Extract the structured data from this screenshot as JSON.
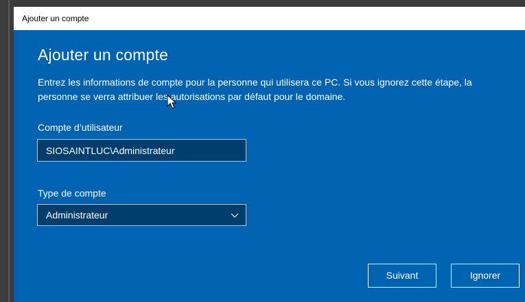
{
  "window": {
    "title": "Ajouter un compte"
  },
  "dialog": {
    "heading": "Ajouter un compte",
    "description": "Entrez les informations de compte pour la personne qui utilisera ce PC. Si vous ignorez cette étape, la personne se verra attribuer les autorisations par défaut pour le domaine."
  },
  "user_account": {
    "label": "Compte d’utilisateur",
    "value": "SIOSAINTLUC\\Administrateur"
  },
  "account_type": {
    "label": "Type de compte",
    "selected": "Administrateur"
  },
  "buttons": {
    "next": "Suivant",
    "ignore": "Ignorer"
  },
  "colors": {
    "accent": "#0063b1",
    "input_bg": "#003e6e"
  },
  "icons": {
    "dropdown": "chevron-down-icon",
    "cursor": "mouse-pointer-icon"
  }
}
